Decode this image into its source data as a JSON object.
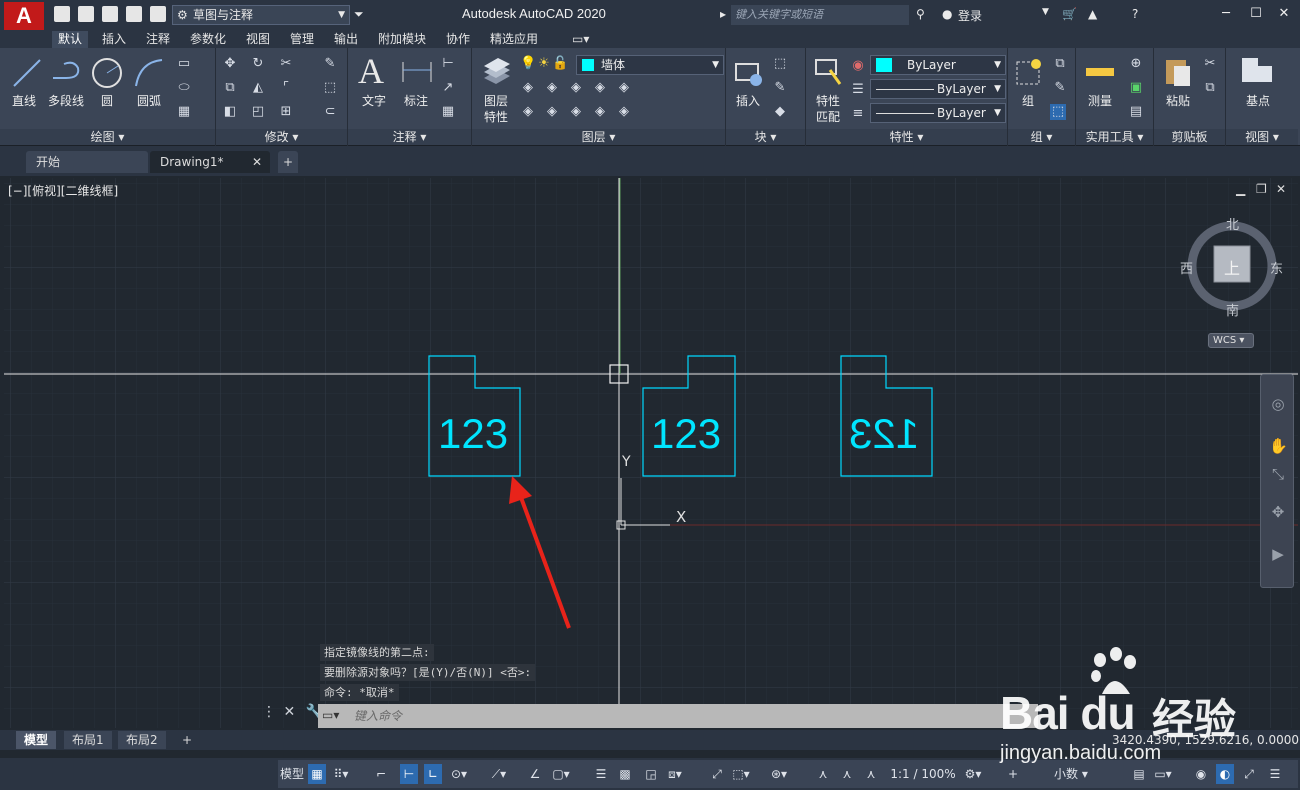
{
  "app": {
    "logo": "A",
    "title": "Autodesk AutoCAD 2020",
    "workspace": "草图与注释",
    "search_placeholder": "键入关键字或短语",
    "login": "登录"
  },
  "ribbon_tabs": [
    "默认",
    "插入",
    "注释",
    "参数化",
    "视图",
    "管理",
    "输出",
    "附加模块",
    "协作",
    "精选应用"
  ],
  "panels": {
    "draw": {
      "title": "绘图",
      "tools": [
        "直线",
        "多段线",
        "圆",
        "圆弧"
      ]
    },
    "modify": {
      "title": "修改"
    },
    "annotation": {
      "title": "注释",
      "tools": [
        "文字",
        "标注"
      ]
    },
    "layers": {
      "title": "图层",
      "tool": "图层\n特性",
      "tool_line1": "图层",
      "tool_line2": "特性",
      "current_layer": "墙体",
      "layer_color": "#00ffff"
    },
    "block": {
      "title": "块",
      "tool": "插入"
    },
    "properties": {
      "title": "特性",
      "tool_line1": "特性",
      "tool_line2": "匹配",
      "color": "ByLayer",
      "linetype": "ByLayer",
      "lineweight": "ByLayer"
    },
    "groups": {
      "title": "组",
      "tool": "组"
    },
    "utilities": {
      "title": "实用工具",
      "tool": "测量"
    },
    "clipboard": {
      "title": "剪贴板",
      "tool": "粘贴"
    },
    "view": {
      "title": "视图",
      "tool": "基点"
    }
  },
  "file_tabs": {
    "start": "开始",
    "drawing": "Drawing1*"
  },
  "viewport": {
    "label": "[−][俯视][二维线框]",
    "compass": {
      "north": "北",
      "south": "南",
      "east": "东",
      "west": "西",
      "top": "上"
    },
    "wcs": "WCS",
    "ucs": {
      "x": "X",
      "y": "Y"
    }
  },
  "drawing_objects": [
    {
      "text": "123",
      "mirrored": false
    },
    {
      "text": "123",
      "mirrored": false
    },
    {
      "text": "123",
      "mirrored": true
    }
  ],
  "colors": {
    "accent": "#00e5ff",
    "annotation_arrow": "#e8231a",
    "background": "#212830"
  },
  "command_history": [
    "指定镜像线的第二点:",
    "要删除源对象吗？[是(Y)/否(N)] <否>:",
    "命令: *取消*"
  ],
  "command_placeholder": "键入命令",
  "layout_tabs": [
    "模型",
    "布局1",
    "布局2"
  ],
  "coordinates": "3420.4390, 1529.6216, 0.0000",
  "statusbar": {
    "model": "模型",
    "scale": "1:1 / 100%",
    "units": "小数"
  },
  "watermark": {
    "brand": "Bai du",
    "cn": "经验",
    "url": "jingyan.baidu.com"
  }
}
